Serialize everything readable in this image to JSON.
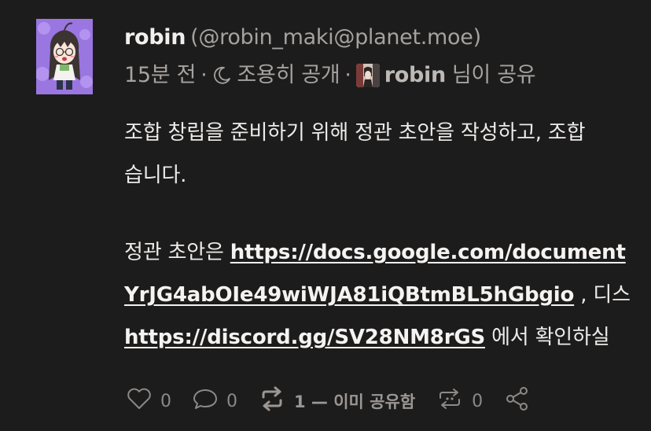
{
  "author": {
    "display_name": "robin",
    "handle": "(@robin_maki@planet.moe)",
    "avatar_icon": "anime-girl-avatar",
    "avatar_bg": "#9a76e0"
  },
  "meta": {
    "time": "15분 전",
    "visibility_icon": "moon-icon",
    "visibility": "조용히 공개",
    "booster_name": "robin",
    "boost_suffix": "님이 공유"
  },
  "content": {
    "p1_line1": "조합 창립을 준비하기 위해 정관 초안을 작성하고, 조합",
    "p1_line2": "습니다.",
    "p2_line1_prefix": "정관 초안은 ",
    "link1_part1": "https://docs.google.com/document",
    "link1_part2": "YrJG4abOIe49wiWJA81iQBtmBL5hGbgio",
    "p2_line2_suffix": " , 디스",
    "link2": "https://discord.gg/SV28NM8rGS",
    "p2_line3_suffix": " 에서 확인하실"
  },
  "actions": {
    "like_count": "0",
    "reply_count": "0",
    "boost_label": "1 — 이미 공유함",
    "quote_count": "0",
    "like_icon": "heart-icon",
    "reply_icon": "speech-bubble-icon",
    "boost_icon": "boost-icon",
    "quote_icon": "quote-icon",
    "share_icon": "share-icon"
  },
  "colors": {
    "background": "#1d1c1c",
    "text": "#ecebe9",
    "muted": "#a5a29f"
  }
}
